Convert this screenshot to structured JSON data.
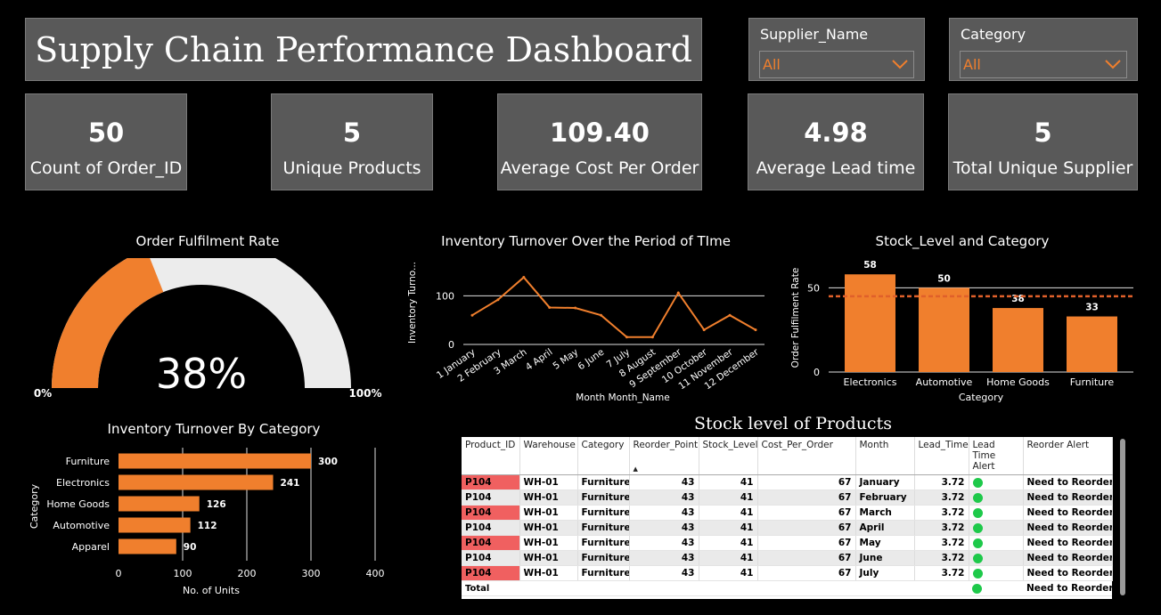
{
  "title": "Supply Chain Performance Dashboard",
  "filters": [
    {
      "label": "Supplier_Name",
      "value": "All"
    },
    {
      "label": "Category",
      "value": "All"
    }
  ],
  "kpis": [
    {
      "value": "50",
      "label": "Count of Order_ID"
    },
    {
      "value": "5",
      "label": "Unique Products"
    },
    {
      "value": "109.40",
      "label": "Average Cost Per Order"
    },
    {
      "value": "4.98",
      "label": "Average Lead time"
    },
    {
      "value": "5",
      "label": "Total Unique Supplier"
    }
  ],
  "gauge": {
    "title": "Order Fulfilment Rate",
    "value_text": "38%",
    "min_label": "0%",
    "max_label": "100%",
    "fraction": 0.38
  },
  "colors": {
    "accent": "#f07f2d",
    "panel": "#595959",
    "gauge_track": "#ececec",
    "ok": "#1ec94a",
    "alert": "#f06060"
  },
  "chart_data": [
    {
      "type": "line",
      "title": "Inventory Turnover Over the Period of TIme",
      "xlabel": "Month Month_Name",
      "ylabel": "Inventory Turno...",
      "categories": [
        "1 January",
        "2 February",
        "3 March",
        "4 April",
        "5 May",
        "6 June",
        "7 July",
        "8 August",
        "9 September",
        "10 October",
        "11 November",
        "12 December"
      ],
      "values": [
        60,
        92,
        138,
        76,
        75,
        60,
        15,
        15,
        106,
        30,
        60,
        30
      ],
      "yticks": [
        0,
        100
      ],
      "ylim": [
        0,
        150
      ]
    },
    {
      "type": "bar",
      "title": "Stock_Level and Category",
      "xlabel": "Category",
      "ylabel": "Order Fulfilment Rate",
      "categories": [
        "Electronics",
        "Automotive",
        "Home Goods",
        "Furniture"
      ],
      "values": [
        58,
        50,
        38,
        33
      ],
      "reference_line": 45,
      "yticks": [
        0,
        50
      ],
      "ylim": [
        0,
        65
      ]
    },
    {
      "type": "bar",
      "orientation": "horizontal",
      "title": "Inventory Turnover By Category",
      "xlabel": "No. of Units",
      "ylabel": "Category",
      "categories": [
        "Furniture",
        "Electronics",
        "Home Goods",
        "Automotive",
        "Apparel"
      ],
      "values": [
        300,
        241,
        126,
        112,
        90
      ],
      "xticks": [
        0,
        100,
        200,
        300,
        400
      ],
      "xlim": [
        0,
        400
      ]
    }
  ],
  "table": {
    "title": "Stock level of Products",
    "columns": [
      "Product_ID",
      "Warehouse",
      "Category",
      "Reorder_Point",
      "Stock_Level",
      "Cost_Per_Order",
      "Month",
      "Lead_Time",
      "Lead Time Alert",
      "Reorder Alert"
    ],
    "rows": [
      [
        "P104",
        "WH-01",
        "Furniture",
        "43",
        "41",
        "67",
        "January",
        "3.72",
        "",
        "Need to Reorder"
      ],
      [
        "P104",
        "WH-01",
        "Furniture",
        "43",
        "41",
        "67",
        "February",
        "3.72",
        "",
        "Need to Reorder"
      ],
      [
        "P104",
        "WH-01",
        "Furniture",
        "43",
        "41",
        "67",
        "March",
        "3.72",
        "",
        "Need to Reorder"
      ],
      [
        "P104",
        "WH-01",
        "Furniture",
        "43",
        "41",
        "67",
        "April",
        "3.72",
        "",
        "Need to Reorder"
      ],
      [
        "P104",
        "WH-01",
        "Furniture",
        "43",
        "41",
        "67",
        "May",
        "3.72",
        "",
        "Need to Reorder"
      ],
      [
        "P104",
        "WH-01",
        "Furniture",
        "43",
        "41",
        "67",
        "June",
        "3.72",
        "",
        "Need to Reorder"
      ],
      [
        "P104",
        "WH-01",
        "Furniture",
        "43",
        "41",
        "67",
        "July",
        "3.72",
        "",
        "Need to Reorder"
      ]
    ],
    "total": {
      "label": "Total",
      "reorder_alert": "Need to Reorder"
    }
  }
}
